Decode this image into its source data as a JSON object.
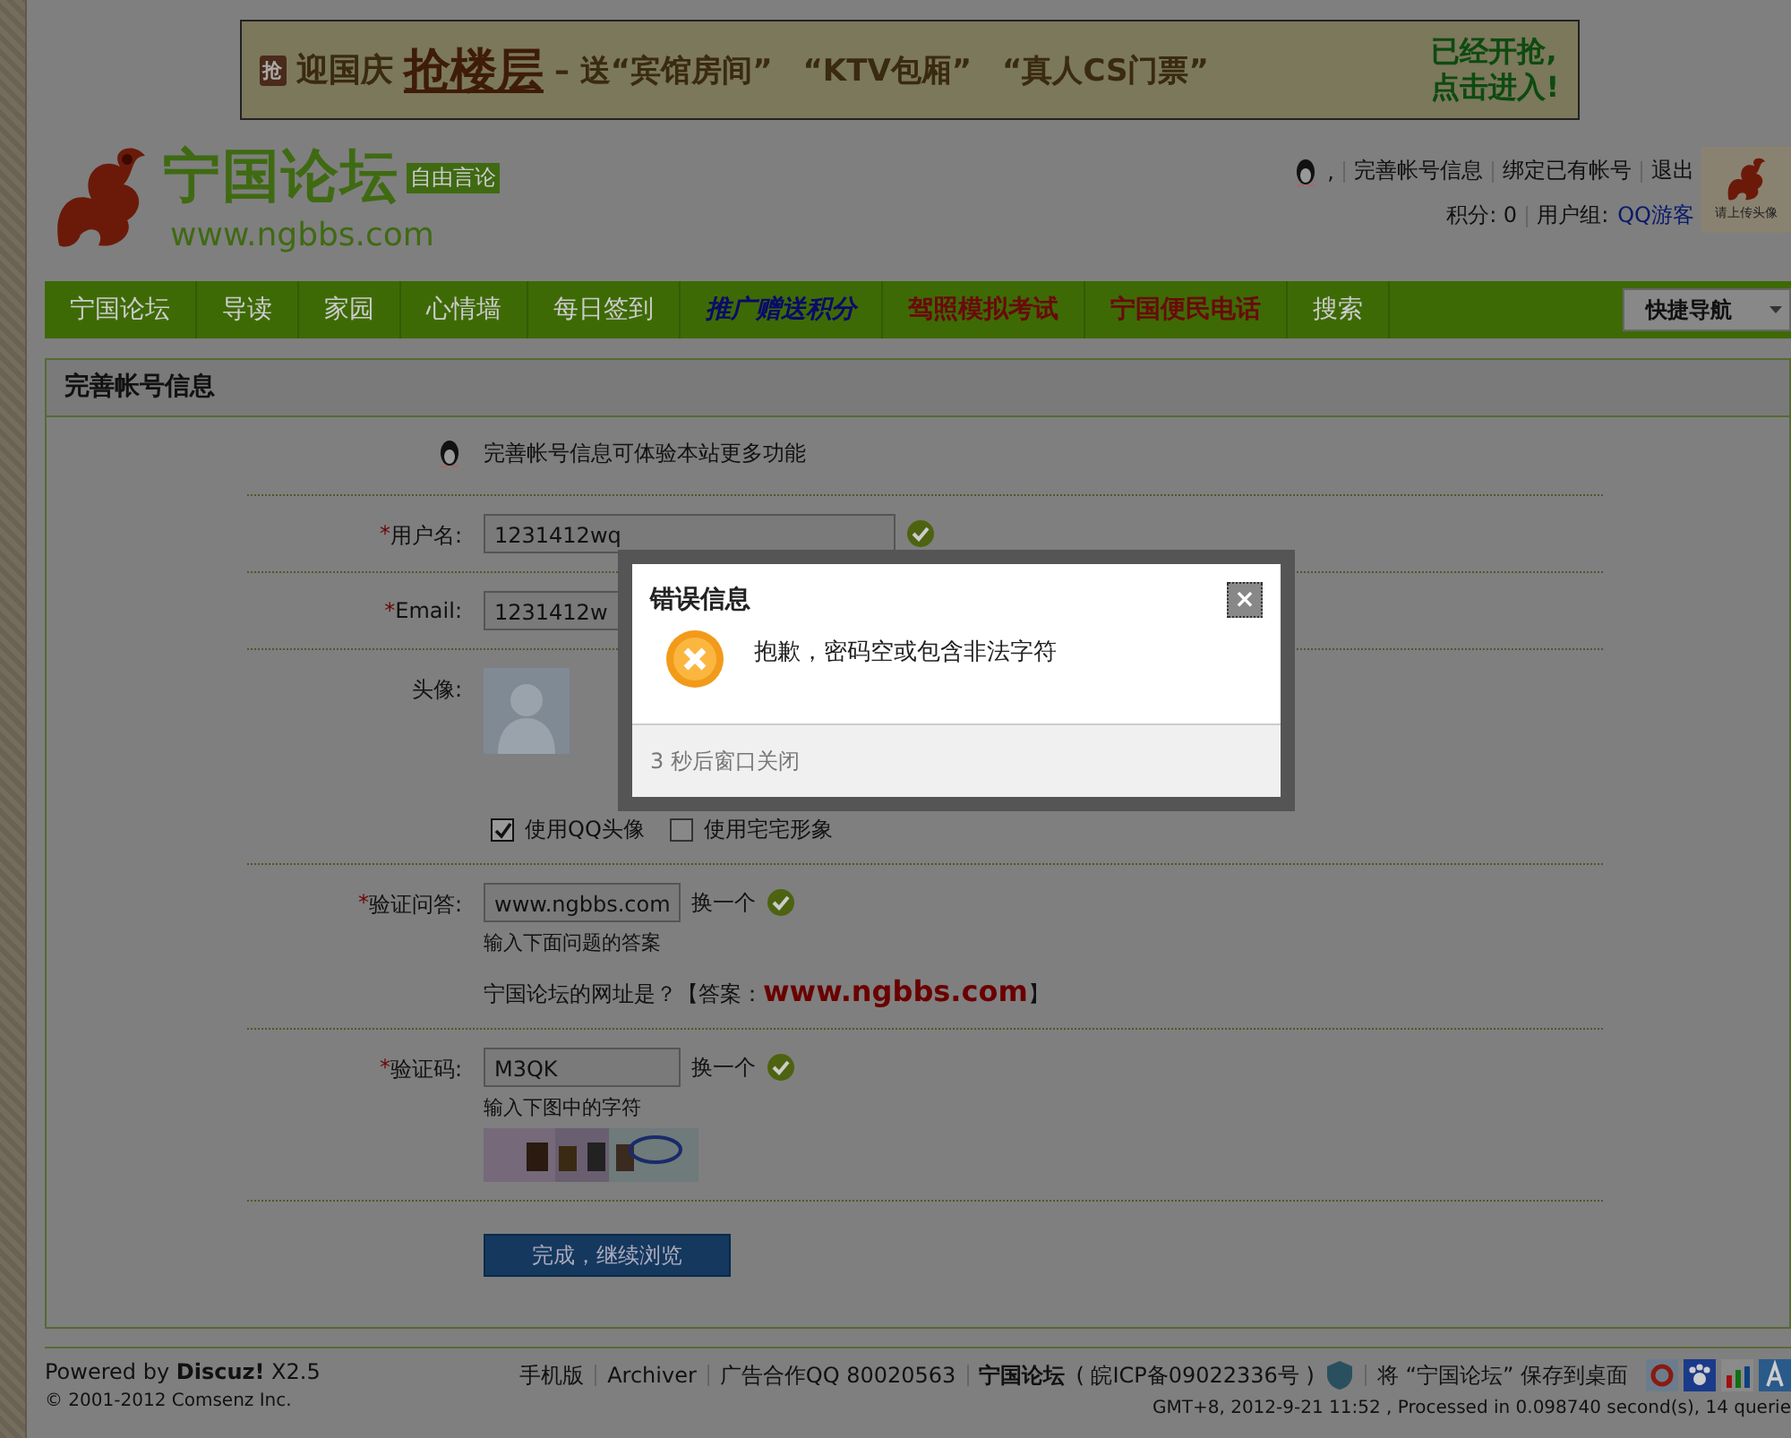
{
  "banner": {
    "badge": "抢",
    "before": "迎国庆",
    "highlight": "抢楼层",
    "after": "– 送“宾馆房间”　“KTV包厢”　“真人CS门票”",
    "cta": [
      "已经开抢,",
      "点击进入!"
    ]
  },
  "logo": {
    "name": "宁国论坛",
    "url": "www.ngbbs.com",
    "tag": "自由言论"
  },
  "user_bar": {
    "separator": ",",
    "links": [
      "完善帐号信息",
      "绑定已有帐号",
      "退出"
    ],
    "points": "积分: 0",
    "group_label": "用户组:",
    "group": "QQ游客",
    "avatar_caption": "请上传头像"
  },
  "nav": {
    "items": [
      {
        "label": "宁国论坛",
        "kind": "normal"
      },
      {
        "label": "导读",
        "kind": "normal"
      },
      {
        "label": "家园",
        "kind": "normal"
      },
      {
        "label": "心情墙",
        "kind": "normal"
      },
      {
        "label": "每日签到",
        "kind": "normal"
      },
      {
        "label": "推广赠送积分",
        "kind": "promo_blue"
      },
      {
        "label": "驾照模拟考试",
        "kind": "promo_red"
      },
      {
        "label": "宁国便民电话",
        "kind": "promo_red"
      },
      {
        "label": "搜索",
        "kind": "normal"
      }
    ],
    "quick_nav": "快捷导航"
  },
  "panel": {
    "title": "完善帐号信息",
    "intro": "完善帐号信息可体验本站更多功能",
    "username": {
      "required_mark": "*",
      "label": "用户名:",
      "value": "1231412wq",
      "valid": true
    },
    "email": {
      "required_mark": "*",
      "label": "Email:",
      "value": "1231412w"
    },
    "avatar": {
      "label": "头像:",
      "options": [
        {
          "label": "使用QQ头像",
          "checked": true
        },
        {
          "label": "使用宅宅形象",
          "checked": false
        }
      ]
    },
    "question": {
      "required_mark": "*",
      "label": "验证问答:",
      "value": "www.ngbbs.com",
      "change": "换一个",
      "valid": true,
      "hint": "输入下面问题的答案",
      "prompt": "宁国论坛的网址是？【答案：",
      "answer": "www.ngbbs.com",
      "prompt_end": "】"
    },
    "captcha": {
      "required_mark": "*",
      "label": "验证码:",
      "value": "M3QK",
      "change": "换一个",
      "valid": true,
      "hint": "输入下图中的字符"
    },
    "submit": "完成，继续浏览"
  },
  "dialog": {
    "title": "错误信息",
    "close": "×",
    "message": "抱歉，密码空或包含非法字符",
    "footer": "3 秒后窗口关闭"
  },
  "footer": {
    "powered": "Powered by **Discuz!** X2.5",
    "copyright": "© 2001-2012 Comsenz Inc.",
    "links": [
      "手机版",
      "Archiver",
      "广告合作QQ 80020563"
    ],
    "site": "宁国论坛",
    "icp": "( 皖ICP备09022336号 )",
    "save": "将 “宁国论坛” 保存到桌面",
    "stats": "GMT+8, 2012-9-21 11:52 , Processed in 0.098740 second(s), 14 querie"
  }
}
